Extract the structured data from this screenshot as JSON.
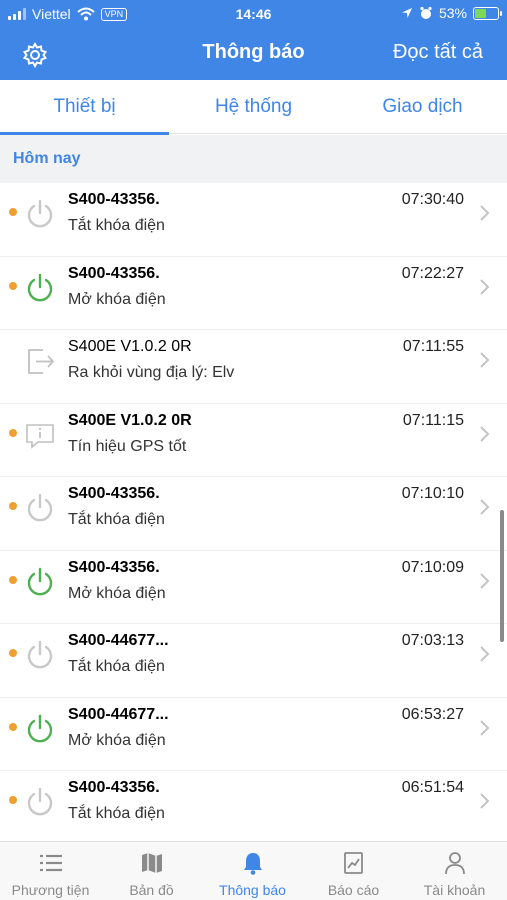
{
  "status_bar": {
    "carrier": "Viettel",
    "vpn": "VPN",
    "time": "14:46",
    "battery": "53%",
    "battery_level": 0.53
  },
  "navbar": {
    "title": "Thông báo",
    "action": "Đọc tất cả"
  },
  "tabs": [
    "Thiết bị",
    "Hệ thống",
    "Giao dịch"
  ],
  "section": "Hôm nay",
  "notifications": [
    {
      "title": "S400-43356.",
      "subtitle": "Tắt khóa điện",
      "time": "07:30:40",
      "icon": "power-off-icon",
      "unread": true
    },
    {
      "title": "S400-43356.",
      "subtitle": "Mở khóa điện",
      "time": "07:22:27",
      "icon": "power-on-icon",
      "unread": true
    },
    {
      "title": "S400E V1.0.2 0R",
      "subtitle": "Ra khỏi vùng địa lý: Elv",
      "time": "07:11:55",
      "icon": "exit-zone-icon",
      "unread": false
    },
    {
      "title": "S400E V1.0.2 0R",
      "subtitle": "Tín hiệu GPS tốt",
      "time": "07:11:15",
      "icon": "info-message-icon",
      "unread": true
    },
    {
      "title": "S400-43356.",
      "subtitle": "Tắt khóa điện",
      "time": "07:10:10",
      "icon": "power-off-icon",
      "unread": true
    },
    {
      "title": "S400-43356.",
      "subtitle": "Mở khóa điện",
      "time": "07:10:09",
      "icon": "power-on-icon",
      "unread": true
    },
    {
      "title": "S400-44677...",
      "subtitle": "Tắt khóa điện",
      "time": "07:03:13",
      "icon": "power-off-icon",
      "unread": true
    },
    {
      "title": "S400-44677...",
      "subtitle": "Mở khóa điện",
      "time": "06:53:27",
      "icon": "power-on-icon",
      "unread": true
    },
    {
      "title": "S400-43356.",
      "subtitle": "Tắt khóa điện",
      "time": "06:51:54",
      "icon": "power-off-icon",
      "unread": true
    }
  ],
  "tabbar": [
    {
      "label": "Phương tiện",
      "icon": "list-icon"
    },
    {
      "label": "Bản đồ",
      "icon": "map-icon"
    },
    {
      "label": "Thông báo",
      "icon": "bell-icon",
      "active": true
    },
    {
      "label": "Báo cáo",
      "icon": "report-icon"
    },
    {
      "label": "Tài khoản",
      "icon": "user-icon"
    }
  ],
  "colors": {
    "primary": "#3f86e6",
    "unread_dot": "#f0a030",
    "power_on": "#4caf50",
    "power_off": "#c8c8c8"
  }
}
